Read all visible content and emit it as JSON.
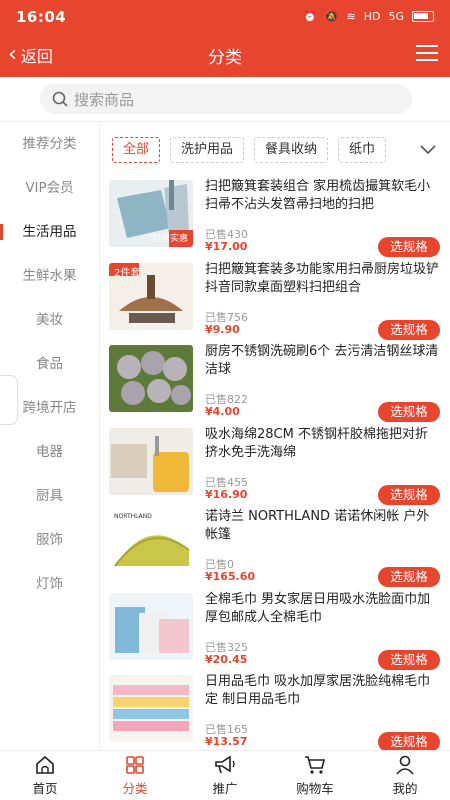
{
  "status": {
    "time": "16:04",
    "network": "5G",
    "wifi": "HD"
  },
  "nav": {
    "back_label": "返回",
    "title": "分类"
  },
  "search": {
    "placeholder": "搜索商品"
  },
  "sidebar": {
    "active_index": 2,
    "items": [
      {
        "label": "推荐分类"
      },
      {
        "label": "VIP会员"
      },
      {
        "label": "生活用品"
      },
      {
        "label": "生鲜水果"
      },
      {
        "label": "美妆"
      },
      {
        "label": "食品"
      },
      {
        "label": "跨境开店"
      },
      {
        "label": "电器"
      },
      {
        "label": "厨具"
      },
      {
        "label": "服饰"
      },
      {
        "label": "灯饰"
      }
    ]
  },
  "tabs": {
    "items": [
      {
        "label": "全部",
        "active": true
      },
      {
        "label": "洗护用品",
        "active": false
      },
      {
        "label": "餐具收纳",
        "active": false
      },
      {
        "label": "纸巾",
        "active": false
      }
    ],
    "more_icon": "chevron-down-icon"
  },
  "products": [
    {
      "name": "扫把簸箕套装组合 家用梳齿撮箕软毛小扫帚不沾头发笤帚扫地的扫把",
      "sold": "已售430",
      "price": "¥17.00",
      "button": "选规格",
      "badge": "好用实惠"
    },
    {
      "name": "扫把簸箕套装多功能家用扫帚厨房垃圾铲抖音同款桌面塑料扫把组合",
      "sold": "已售756",
      "price": "¥9.90",
      "button": "选规格",
      "badge": "2件套"
    },
    {
      "name": "厨房不锈钢洗碗刷6个 去污清洁钢丝球清洁球",
      "sold": "已售822",
      "price": "¥4.00",
      "button": "选规格"
    },
    {
      "name": "吸水海绵28CM 不锈钢杆胶棉拖把对折挤水免手洗海绵",
      "sold": "已售455",
      "price": "¥16.90",
      "button": "选规格"
    },
    {
      "name": "诺诗兰 NORTHLAND 诺诺休闲帐 户外帐篷",
      "sold": "已售0",
      "price": "¥165.60",
      "button": "选规格",
      "badge": "NORTHLAND"
    },
    {
      "name": "全棉毛巾 男女家居日用吸水洗脸面巾加厚包邮成人全棉毛巾",
      "sold": "已售325",
      "price": "¥20.45",
      "button": "选规格"
    },
    {
      "name": "日用品毛巾 吸水加厚家居洗脸纯棉毛巾定 制日用品毛巾",
      "sold": "已售165",
      "price": "¥13.57",
      "button": "选规格"
    }
  ],
  "tabbar": {
    "active_index": 1,
    "items": [
      {
        "label": "首页",
        "icon": "home-icon"
      },
      {
        "label": "分类",
        "icon": "category-grid-icon"
      },
      {
        "label": "推广",
        "icon": "megaphone-icon"
      },
      {
        "label": "购物车",
        "icon": "cart-icon"
      },
      {
        "label": "我的",
        "icon": "user-icon"
      }
    ]
  },
  "colors": {
    "accent": "#e8452e",
    "text": "#222222",
    "muted": "#999999"
  }
}
